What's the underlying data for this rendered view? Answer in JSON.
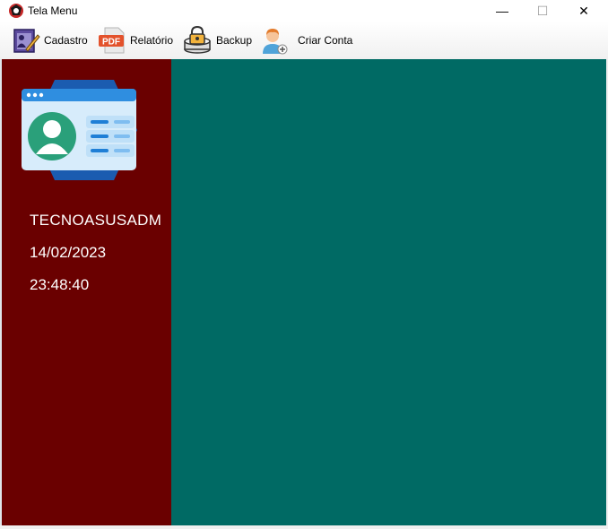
{
  "window": {
    "title": "Tela Menu"
  },
  "toolbar": {
    "items": [
      {
        "label": "Cadastro",
        "icon": "cadastro-icon"
      },
      {
        "label": "Relatório",
        "icon": "pdf-icon",
        "icon_text": "PDF"
      },
      {
        "label": "Backup",
        "icon": "backup-icon"
      },
      {
        "label": "Criar Conta",
        "icon": "add-user-icon"
      }
    ]
  },
  "sidebar": {
    "user": "TECNOASUSADM",
    "date": "14/02/2023",
    "time": "23:48:40"
  },
  "colors": {
    "sidebar_bg": "#6a0000",
    "content_bg": "#006a64",
    "text": "#ffffff"
  }
}
